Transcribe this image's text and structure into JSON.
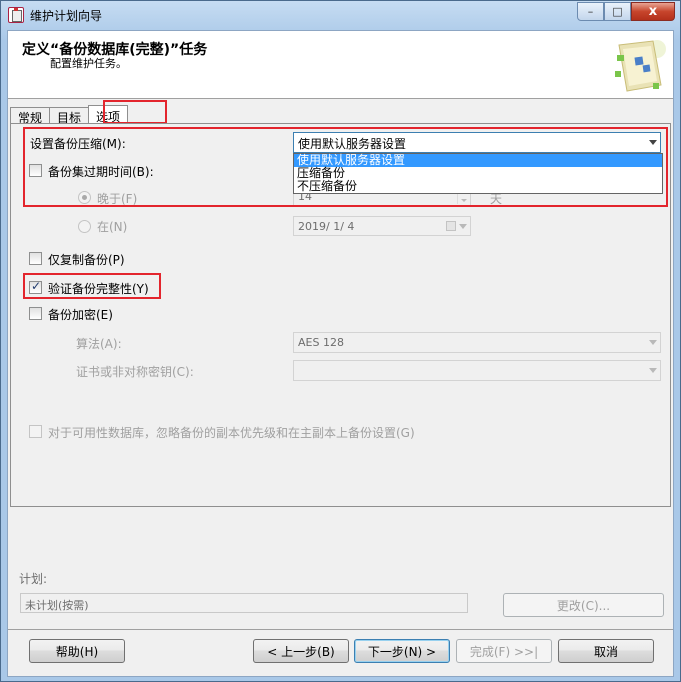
{
  "window": {
    "title": "维护计划向导",
    "minimize": "–",
    "maximize": "□",
    "close": "x"
  },
  "header": {
    "title": "定义“备份数据库(完整)”任务",
    "subtitle": "配置维护任务。"
  },
  "tabs": [
    {
      "label": "常规"
    },
    {
      "label": "目标"
    },
    {
      "label": "选项"
    }
  ],
  "options": {
    "compression_label": "设置备份压缩(M):",
    "compression_value": "使用默认服务器设置",
    "compression_options": [
      "使用默认服务器设置",
      "压缩备份",
      "不压缩备份"
    ],
    "expire_label": "备份集过期时间(B):",
    "after_label": "晚于(F)",
    "after_value": "14",
    "after_unit": "天",
    "on_label": "在(N)",
    "on_value": "2019/ 1/ 4",
    "copy_only_label": "仅复制备份(P)",
    "verify_label": "验证备份完整性(Y)",
    "encrypt_label": "备份加密(E)",
    "algorithm_label": "算法(A):",
    "algorithm_value": "AES 128",
    "cert_label": "证书或非对称密钥(C):",
    "cert_value": "",
    "ag_label": "对于可用性数据库，忽略备份的副本优先级和在主副本上备份设置(G)"
  },
  "schedule": {
    "label": "计划:",
    "value": "未计划(按需)",
    "change_button": "更改(C)..."
  },
  "footer": {
    "help": "帮助(H)",
    "back": "< 上一步(B)",
    "next": "下一步(N) >",
    "finish": "完成(F) >>|",
    "cancel": "取消"
  },
  "colors": {
    "highlight_red": "#e3252d",
    "selection_blue": "#3399ff"
  }
}
